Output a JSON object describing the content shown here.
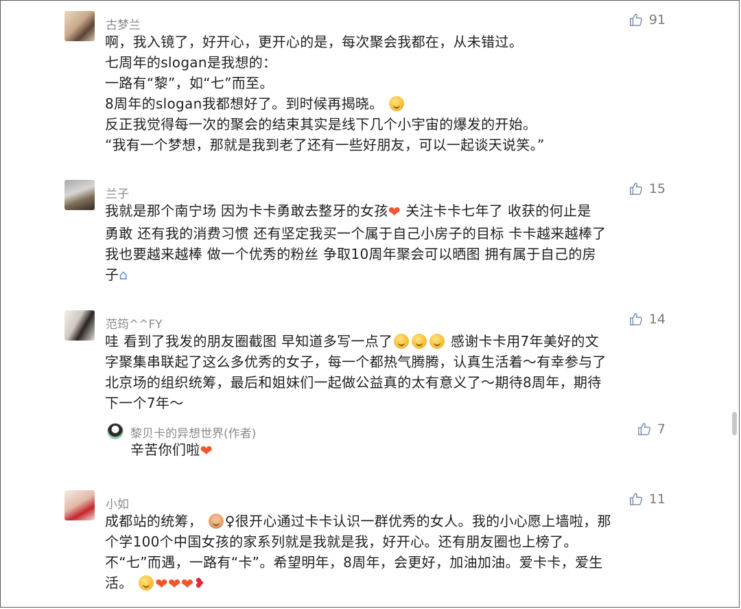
{
  "comments": [
    {
      "username": "古梦兰",
      "likes": "91",
      "lines": [
        "啊，我入镜了，好开心，更开心的是，每次聚会我都在，从未错过。",
        "七周年的slogan是我想的：",
        "一路有“黎”，如“七”而至。",
        "8周年的slogan我都想好了。到时候再揭晓。",
        "反正我觉得每一次的聚会的结束其实是线下几个小宇宙的爆发的开始。",
        "“我有一个梦想，那就是我到老了还有一些好朋友，可以一起谈天说笑。”"
      ]
    },
    {
      "username": "兰子",
      "likes": "15",
      "lines": [
        "我就是那个南宁场  因为卡卡勇敢去整牙的女孩",
        "关注卡卡七年了 收获的何止是",
        "勇敢 还有我的消费习惯  还有坚定我买一个属于自己小房子的目标 卡卡越来越棒了",
        "我也要越来越棒  做一个优秀的粉丝  争取10周年聚会可以晒图  拥有属于自己的房",
        "子"
      ]
    },
    {
      "username": "范筠^^FY",
      "likes": "14",
      "lines": [
        "哇 看到了我发的朋友圈截图 早知道多写一点了",
        "感谢卡卡用7年美好的文",
        "字聚集串联起了这么多优秀的女子，每一个都热气腾腾，认真生活着～有幸参与了",
        "北京场的组织统筹，最后和姐妹们一起做公益真的太有意义了～期待8周年，期待",
        "下一个7年～"
      ]
    },
    {
      "username": "小如",
      "likes": "11",
      "lines": [
        "成都站的统筹，",
        "♀很开心通过卡卡认识一群优秀的女人。我的小心愿上墙啦，那",
        "个学100个中国女孩的家系列就是我就是我，好开心。还有朋友圈也上榜了。",
        "不“七”而遇，一路有“卡”。希望明年，8周年，会更好，加油加油。爱卡卡，爱生",
        "活。"
      ]
    }
  ],
  "reply": {
    "username": "黎贝卡的异想世界(作者)",
    "likes": "7",
    "text": "辛苦你们啦"
  },
  "emoji": {
    "grin": "grinning-face-emoji",
    "heart": "❤",
    "house": "⌂",
    "lips": "❥",
    "person": "🙋"
  }
}
